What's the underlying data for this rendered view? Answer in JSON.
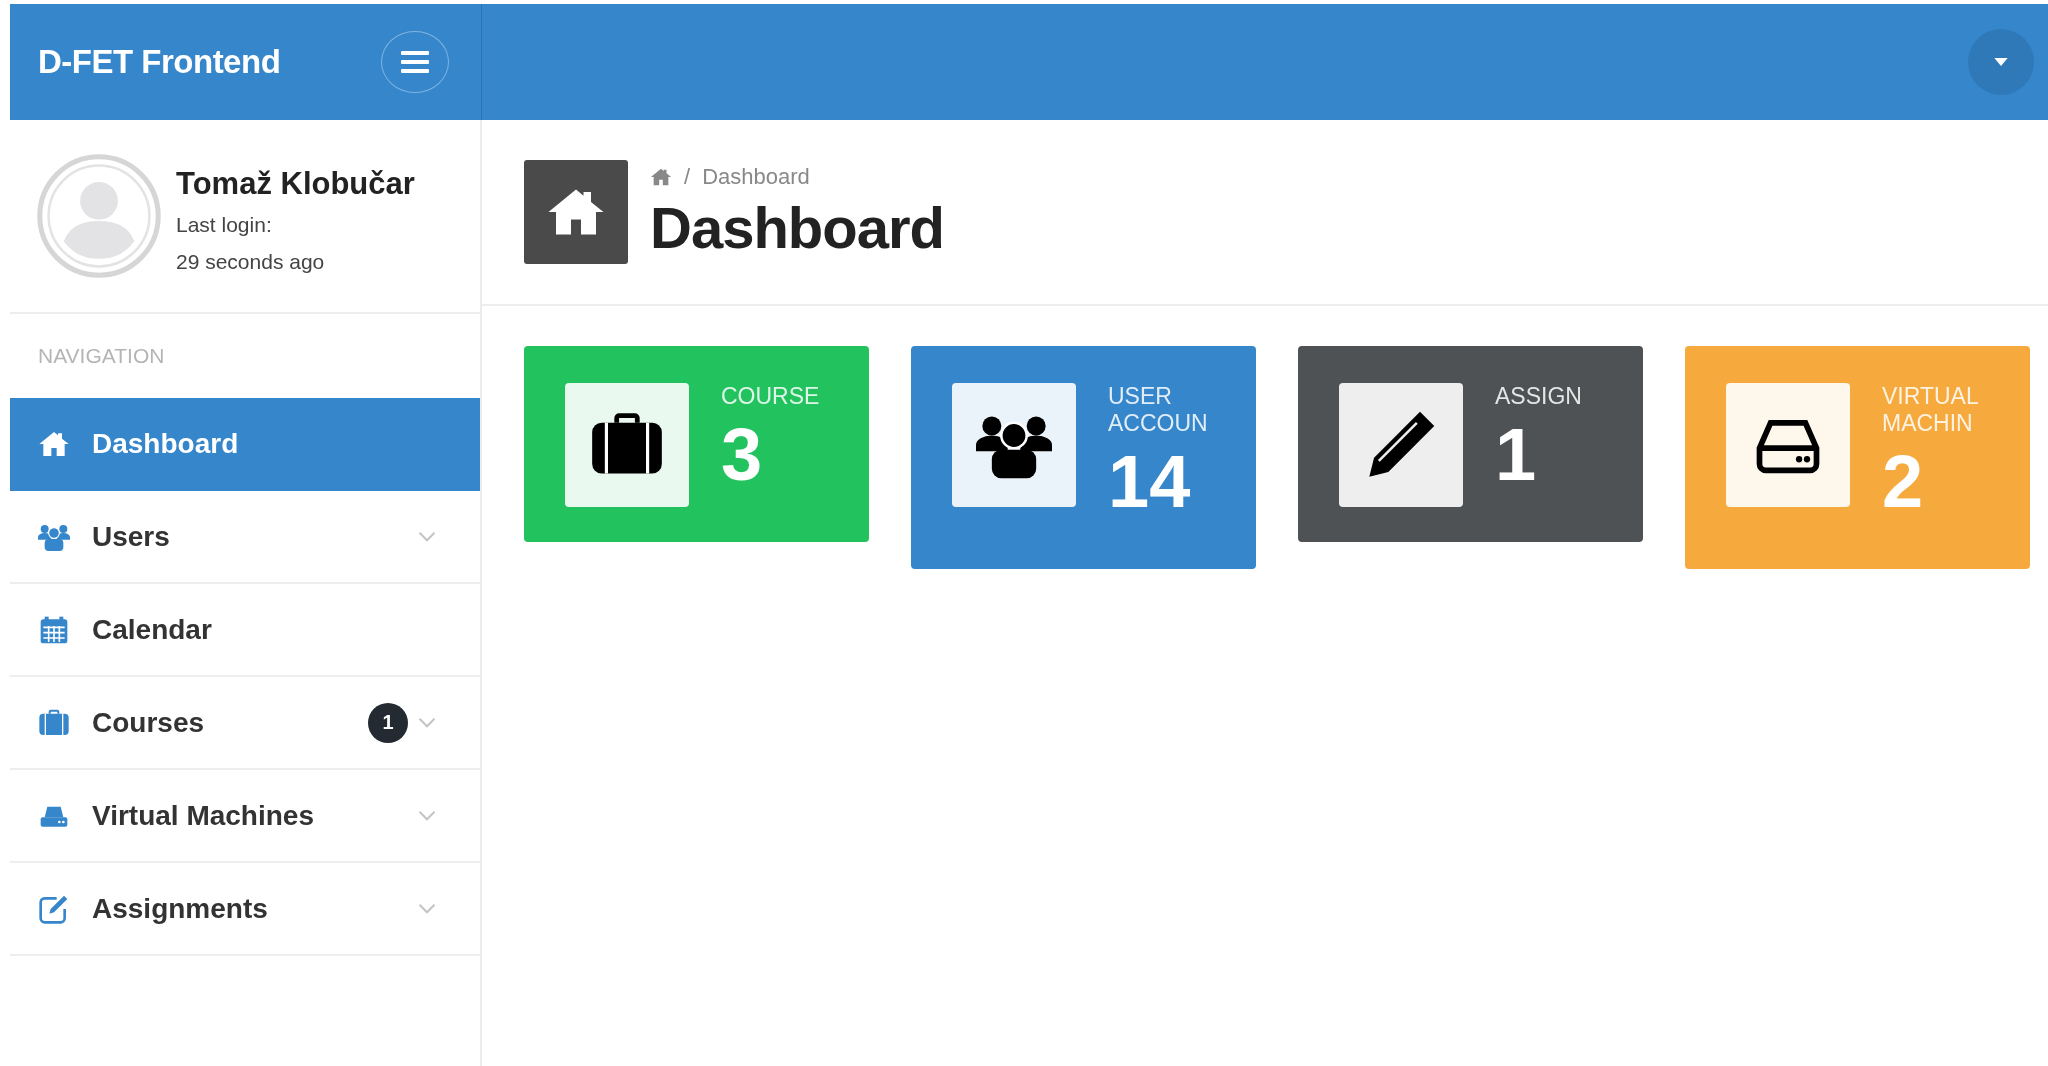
{
  "header": {
    "brand": "D-FET Frontend"
  },
  "profile": {
    "name": "Tomaž Klobučar",
    "last_login_label": "Last login:",
    "last_login": "29 seconds ago"
  },
  "sidebar": {
    "heading": "NAVIGATION",
    "items": [
      {
        "label": "Dashboard",
        "kind": "home",
        "selected": true,
        "expandable": false
      },
      {
        "label": "Users",
        "kind": "users",
        "selected": false,
        "expandable": true
      },
      {
        "label": "Calendar",
        "kind": "calendar",
        "selected": false,
        "expandable": false
      },
      {
        "label": "Courses",
        "kind": "briefcase",
        "selected": false,
        "expandable": true,
        "badge": "1"
      },
      {
        "label": "Virtual Machines",
        "kind": "drive",
        "selected": false,
        "expandable": true
      },
      {
        "label": "Assignments",
        "kind": "edit",
        "selected": false,
        "expandable": true
      }
    ]
  },
  "breadcrumb": [
    {
      "separator": "/",
      "label": "Dashboard"
    }
  ],
  "page_title": "Dashboard",
  "cards": [
    {
      "label": "COURSE",
      "value": "3",
      "kind": "briefcase",
      "color": "#22c35e"
    },
    {
      "label": "USER ACCOUN",
      "value": "14",
      "kind": "users",
      "color": "#3586cb"
    },
    {
      "label": "ASSIGN",
      "value": "1",
      "kind": "pencil",
      "color": "#4f5254"
    },
    {
      "label": "VIRTUAL MACHIN",
      "value": "2",
      "kind": "drive",
      "color": "#f6aa3e"
    }
  ]
}
